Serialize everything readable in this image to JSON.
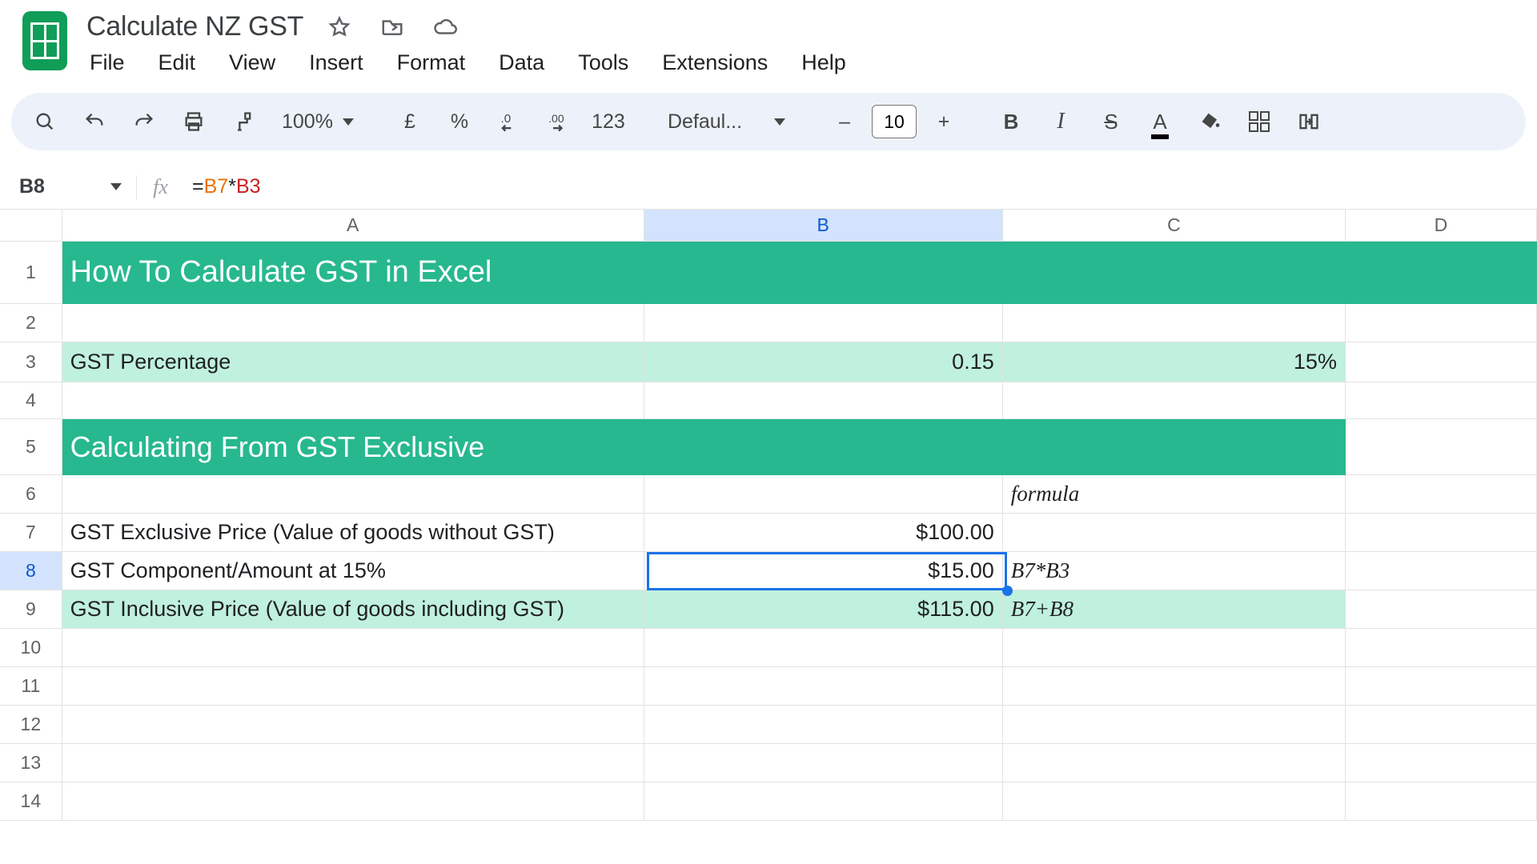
{
  "doc": {
    "title": "Calculate NZ GST"
  },
  "menus": {
    "file": "File",
    "edit": "Edit",
    "view": "View",
    "insert": "Insert",
    "format": "Format",
    "data": "Data",
    "tools": "Tools",
    "extensions": "Extensions",
    "help": "Help"
  },
  "toolbar": {
    "zoom": "100%",
    "currency": "£",
    "percent": "%",
    "dec_less": ".0",
    "dec_more": ".00",
    "numfmt": "123",
    "font": "Defaul...",
    "size": "10",
    "bold": "B",
    "italic": "I",
    "strike": "S",
    "textcolor": "A"
  },
  "fx": {
    "cellref": "B8",
    "formula_eq": "=",
    "formula_r1": "B7",
    "formula_op": "*",
    "formula_r2": "B3"
  },
  "cols": {
    "A": "A",
    "B": "B",
    "C": "C",
    "D": "D"
  },
  "rows": {
    "1": {
      "A": "How To Calculate GST in Excel"
    },
    "3": {
      "A": "GST Percentage",
      "B": "0.15",
      "C": "15%"
    },
    "5": {
      "A": "Calculating From GST Exclusive"
    },
    "6": {
      "C": "formula"
    },
    "7": {
      "A": "GST Exclusive Price (Value of goods without GST)",
      "B": "$100.00"
    },
    "8": {
      "A": "GST Component/Amount at 15%",
      "B": "$15.00",
      "C": "B7*B3"
    },
    "9": {
      "A": "GST Inclusive Price (Value of goods including GST)",
      "B": "$115.00",
      "C": "B7+B8"
    }
  },
  "chart_data": {
    "type": "table",
    "title": "How To Calculate GST in Excel",
    "gst_percentage_decimal": 0.15,
    "gst_percentage_label": "15%",
    "section": "Calculating From GST Exclusive",
    "rows": [
      {
        "label": "GST Exclusive Price (Value of goods without GST)",
        "value": 100.0,
        "formula": ""
      },
      {
        "label": "GST Component/Amount at 15%",
        "value": 15.0,
        "formula": "B7*B3"
      },
      {
        "label": "GST Inclusive Price (Value of goods including GST)",
        "value": 115.0,
        "formula": "B7+B8"
      }
    ],
    "active_cell": "B8",
    "active_formula": "=B7*B3"
  }
}
